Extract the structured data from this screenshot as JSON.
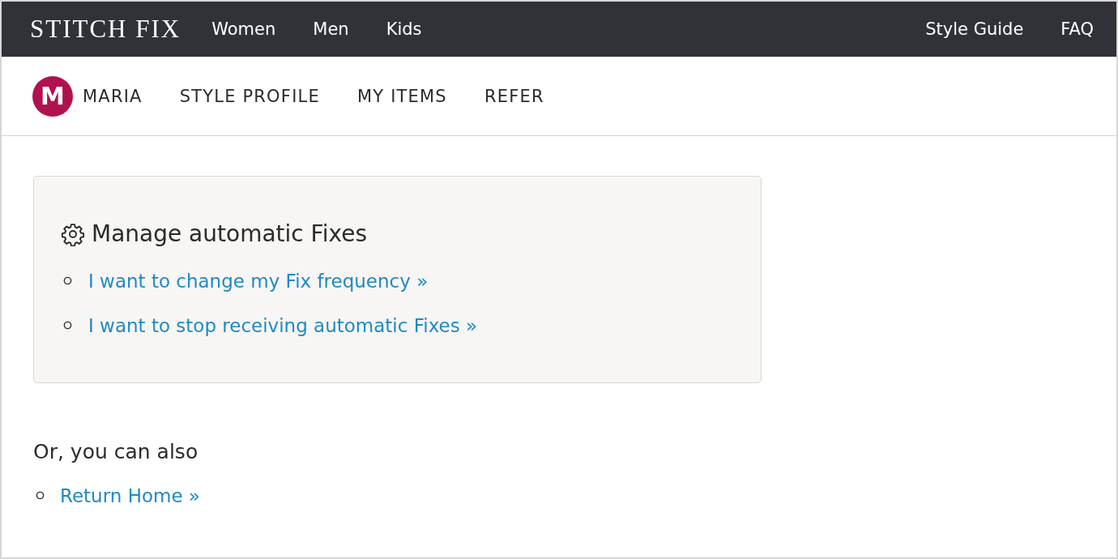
{
  "top_nav": {
    "logo": "STITCH FIX",
    "links": [
      "Women",
      "Men",
      "Kids"
    ],
    "right_links": [
      "Style Guide",
      "FAQ"
    ]
  },
  "account_nav": {
    "avatar_letter": "M",
    "user": "MARIA",
    "links": [
      "STYLE PROFILE",
      "MY ITEMS",
      "REFER"
    ]
  },
  "panel": {
    "title": "Manage automatic Fixes",
    "links": [
      "I want to change my Fix frequency »",
      "I want to stop receiving automatic Fixes »"
    ]
  },
  "other": {
    "heading": "Or, you can also",
    "links": [
      "Return Home »"
    ]
  }
}
